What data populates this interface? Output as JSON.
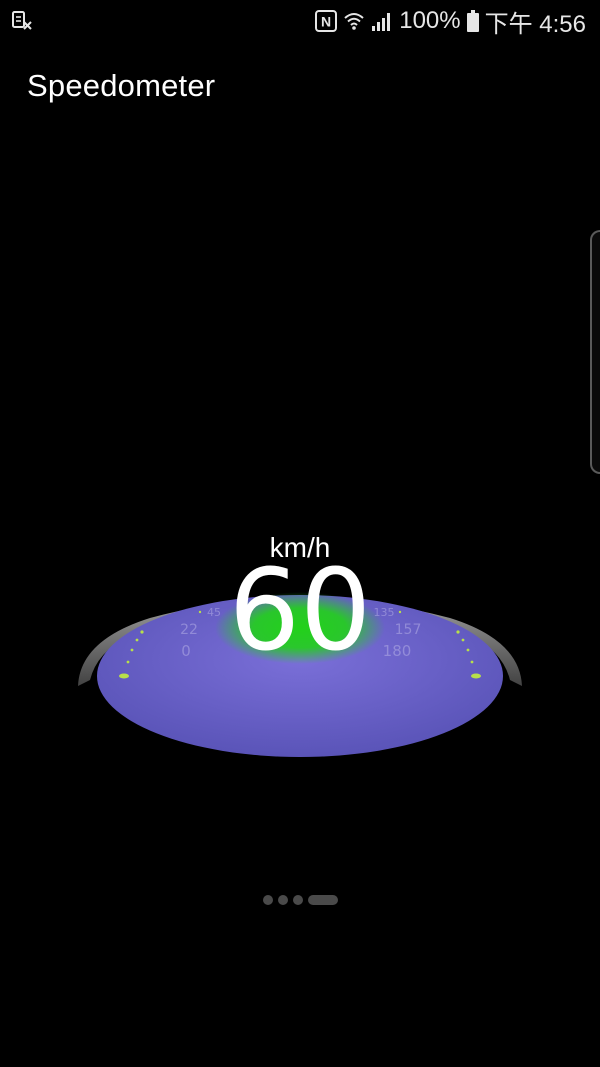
{
  "status_bar": {
    "battery_percent": "100%",
    "time": "下午 4:56",
    "nfc_label": "N",
    "icons": [
      "screenshot-icon",
      "nfc-icon",
      "wifi-icon",
      "signal-icon",
      "battery-icon"
    ]
  },
  "app": {
    "title": "Speedometer"
  },
  "speedometer": {
    "unit": "km/h",
    "speed": "60",
    "dial_labels": [
      "0",
      "22",
      "45",
      "...",
      "135",
      "157",
      "180"
    ],
    "colors": {
      "dial": "#6a5fc6",
      "glow": "#22d11a",
      "rim": "#8a8a8a",
      "tick": "#b8e04a"
    }
  },
  "pager": {
    "pages": 4,
    "active_index": 3
  }
}
